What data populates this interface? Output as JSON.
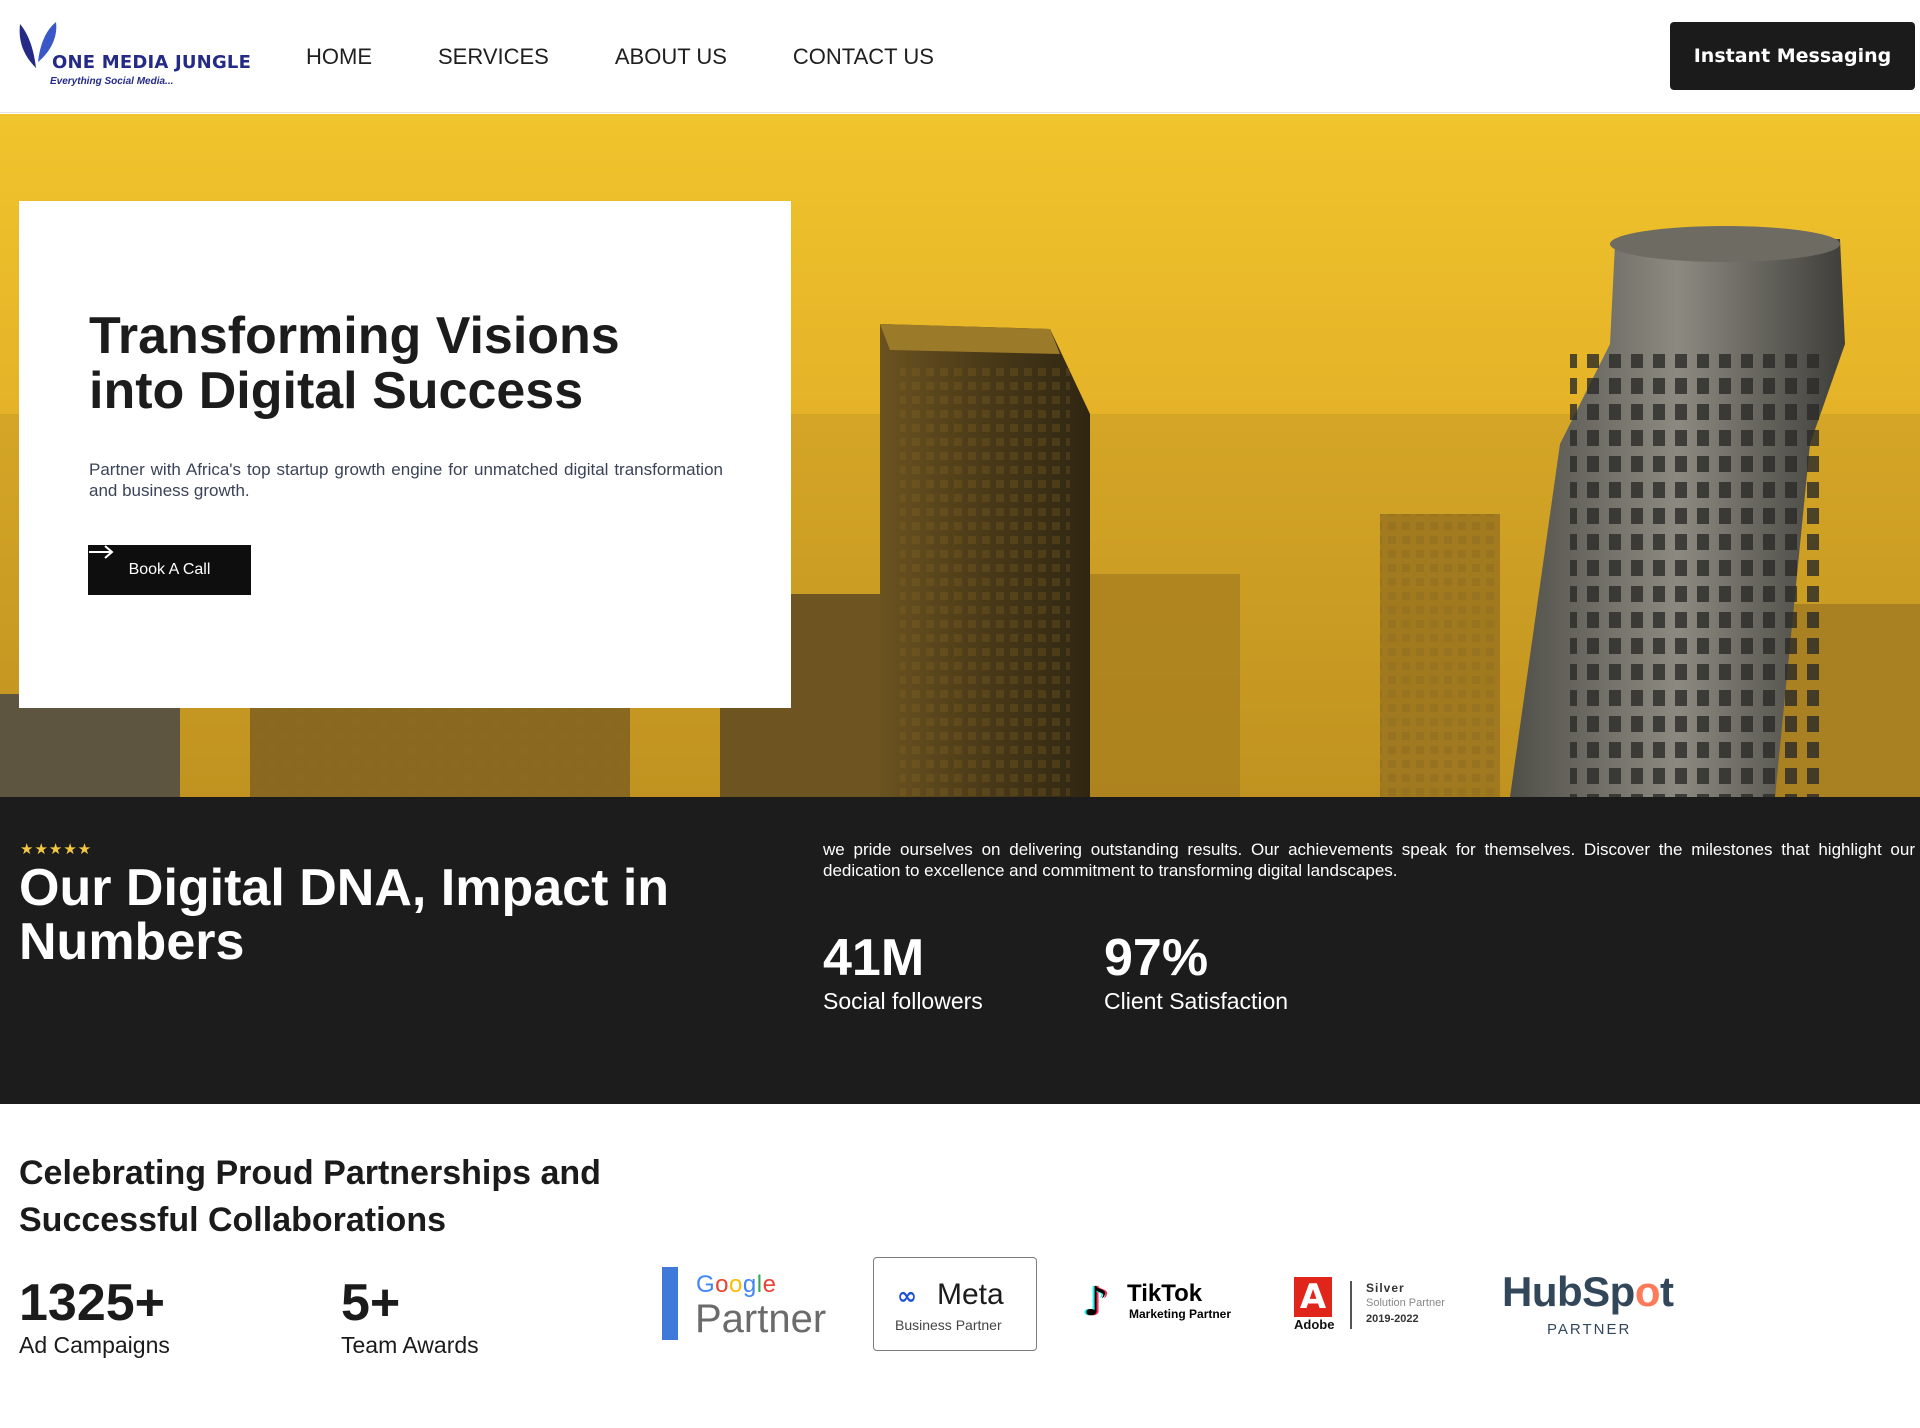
{
  "header": {
    "logo": {
      "name": "ONE MEDIA JUNGLE",
      "tagline": "Everything Social Media..."
    },
    "nav": [
      "HOME",
      "SERVICES",
      "ABOUT US",
      "CONTACT US"
    ],
    "cta_label": "Instant Messaging"
  },
  "hero": {
    "title": "Transforming Visions into Digital Success",
    "subtitle": "Partner with Africa's top startup growth engine for unmatched digital transformation and business growth.",
    "button_label": "Book A Call",
    "button_icon": "arrow-right-icon"
  },
  "stats": {
    "rating_stars": "★★★★★",
    "title": "Our Digital DNA, Impact in Numbers",
    "description": "we pride ourselves on delivering outstanding results. Our achievements speak for themselves. Discover the milestones that highlight our dedication to excellence and commitment to transforming digital landscapes.",
    "items": [
      {
        "value": "41M",
        "label": "Social followers"
      },
      {
        "value": "97%",
        "label": "Client Satisfaction"
      }
    ]
  },
  "partners": {
    "title": "Celebrating Proud Partnerships and Successful Collaborations",
    "items": [
      {
        "value": "1325+",
        "label": "Ad Campaigns"
      },
      {
        "value": "5+",
        "label": "Team Awards"
      }
    ],
    "logos": {
      "google": {
        "word": "Google",
        "sub": "Partner"
      },
      "meta": {
        "word": "Meta",
        "sub": "Business Partner"
      },
      "tiktok": {
        "word": "TikTok",
        "sub": "Marketing Partner"
      },
      "adobe": {
        "word": "Adobe",
        "tier": "Silver",
        "sub": "Solution Partner",
        "years": "2019-2022"
      },
      "hubspot": {
        "word": "HubSpot",
        "sub": "PARTNER"
      }
    }
  },
  "colors": {
    "brand_navy": "#242a86",
    "dark": "#1c1c1c",
    "hero_gold": "#e9b82a",
    "star": "#f2c744"
  }
}
